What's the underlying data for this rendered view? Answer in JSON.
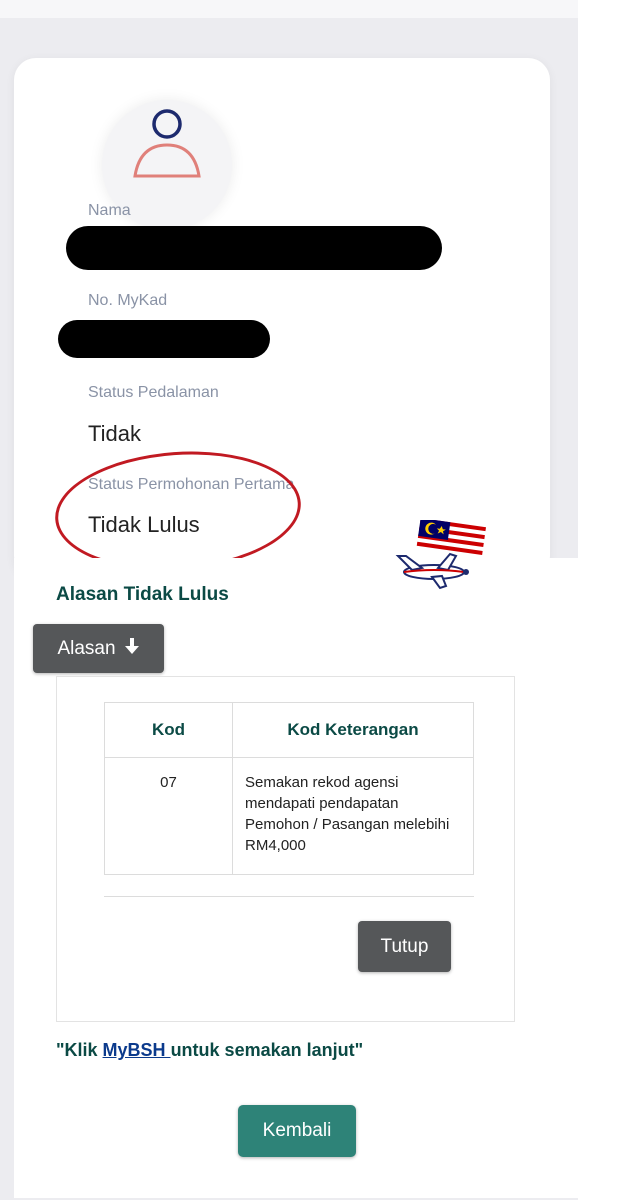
{
  "profile": {
    "avatar_icon": "user-icon",
    "fields": [
      {
        "label": "Nama",
        "value": ""
      },
      {
        "label": "No. MyKad",
        "value": ""
      },
      {
        "label": "Status Pedalaman",
        "value": "Tidak"
      },
      {
        "label": "Status Permohonan Pertama",
        "value": "Tidak Lulus"
      }
    ]
  },
  "reason": {
    "title": "Alasan Tidak Lulus",
    "toggle_label": "Alasan",
    "toggle_icon": "arrow-down-icon",
    "table": {
      "headers": [
        "Kod",
        "Kod Keterangan"
      ],
      "rows": [
        {
          "kod": "07",
          "keterangan": "Semakan rekod agensi mendapati pendapatan Pemohon / Pasangan melebihi RM4,000"
        }
      ]
    },
    "close_label": "Tutup"
  },
  "footer": {
    "link_prefix": "\"Klik ",
    "link_text": "MyBSH ",
    "link_suffix": "untuk semakan lanjut\"",
    "back_label": "Kembali"
  },
  "colors": {
    "primary_teal": "#2e8378",
    "heading_green": "#0b4a45",
    "button_grey": "#555759",
    "annotation_red": "#c11a22"
  },
  "decorations": {
    "sticker_icon": "malaysia-flag-airplane-sticker"
  }
}
